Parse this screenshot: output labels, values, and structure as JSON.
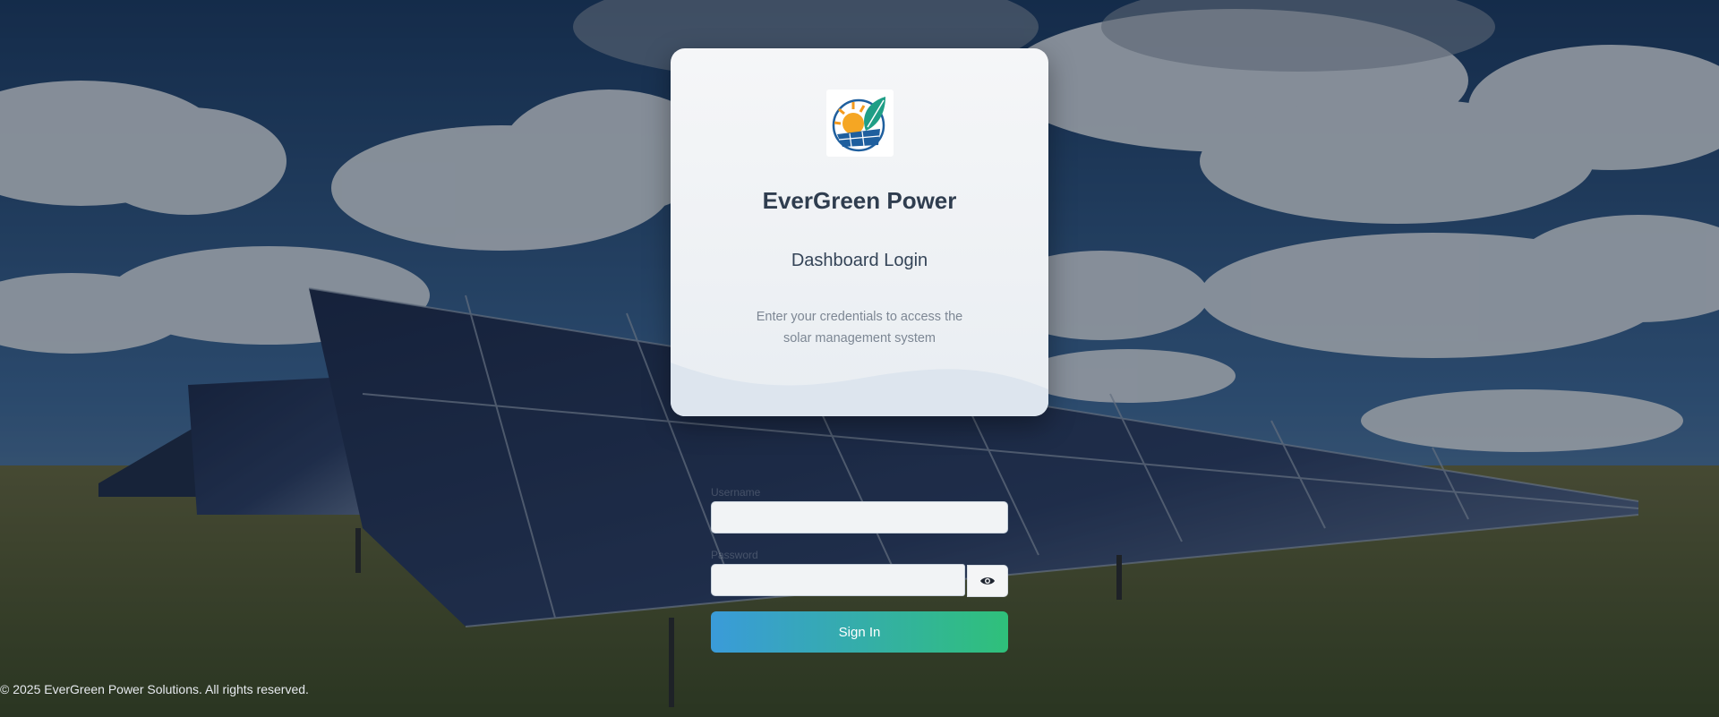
{
  "brand": {
    "name": "EverGreen Power",
    "logo": "evergreen-sun-leaf-logo"
  },
  "login": {
    "title": "Dashboard Login",
    "description": "Enter your credentials to access the solar management system"
  },
  "form": {
    "username_label": "Username",
    "username_value": "",
    "password_label": "Password",
    "password_value": "",
    "toggle_icon": "eye-icon",
    "submit_label": "Sign In"
  },
  "footer": {
    "copyright": "© 2025 EverGreen Power Solutions. All rights reserved."
  },
  "colors": {
    "button_gradient_start": "#3a9bd9",
    "button_gradient_end": "#2fc07a",
    "title_text": "#2f3d4f"
  }
}
